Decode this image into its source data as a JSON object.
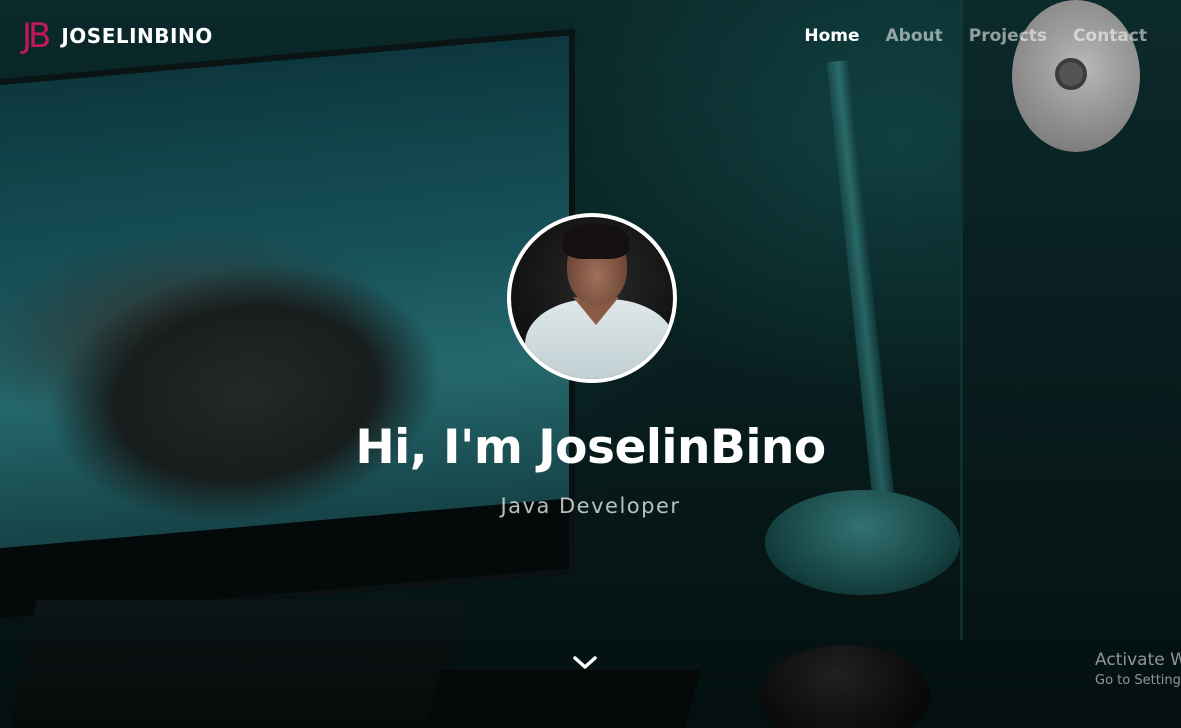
{
  "brand": {
    "logo_mark": "JB",
    "name": "JOSELINBINO",
    "accent_color": "#c2185b"
  },
  "nav": {
    "items": [
      {
        "label": "Home",
        "active": true
      },
      {
        "label": "About",
        "active": false
      },
      {
        "label": "Projects",
        "active": false
      },
      {
        "label": "Contact",
        "active": false
      }
    ]
  },
  "hero": {
    "avatar_icon": "profile-photo",
    "headline": "Hi, I'm JoselinBino",
    "subtitle": "Java Developer",
    "scroll_icon": "chevron-down-icon"
  },
  "os_watermark": {
    "title": "Activate W",
    "subtitle": "Go to Setting"
  }
}
